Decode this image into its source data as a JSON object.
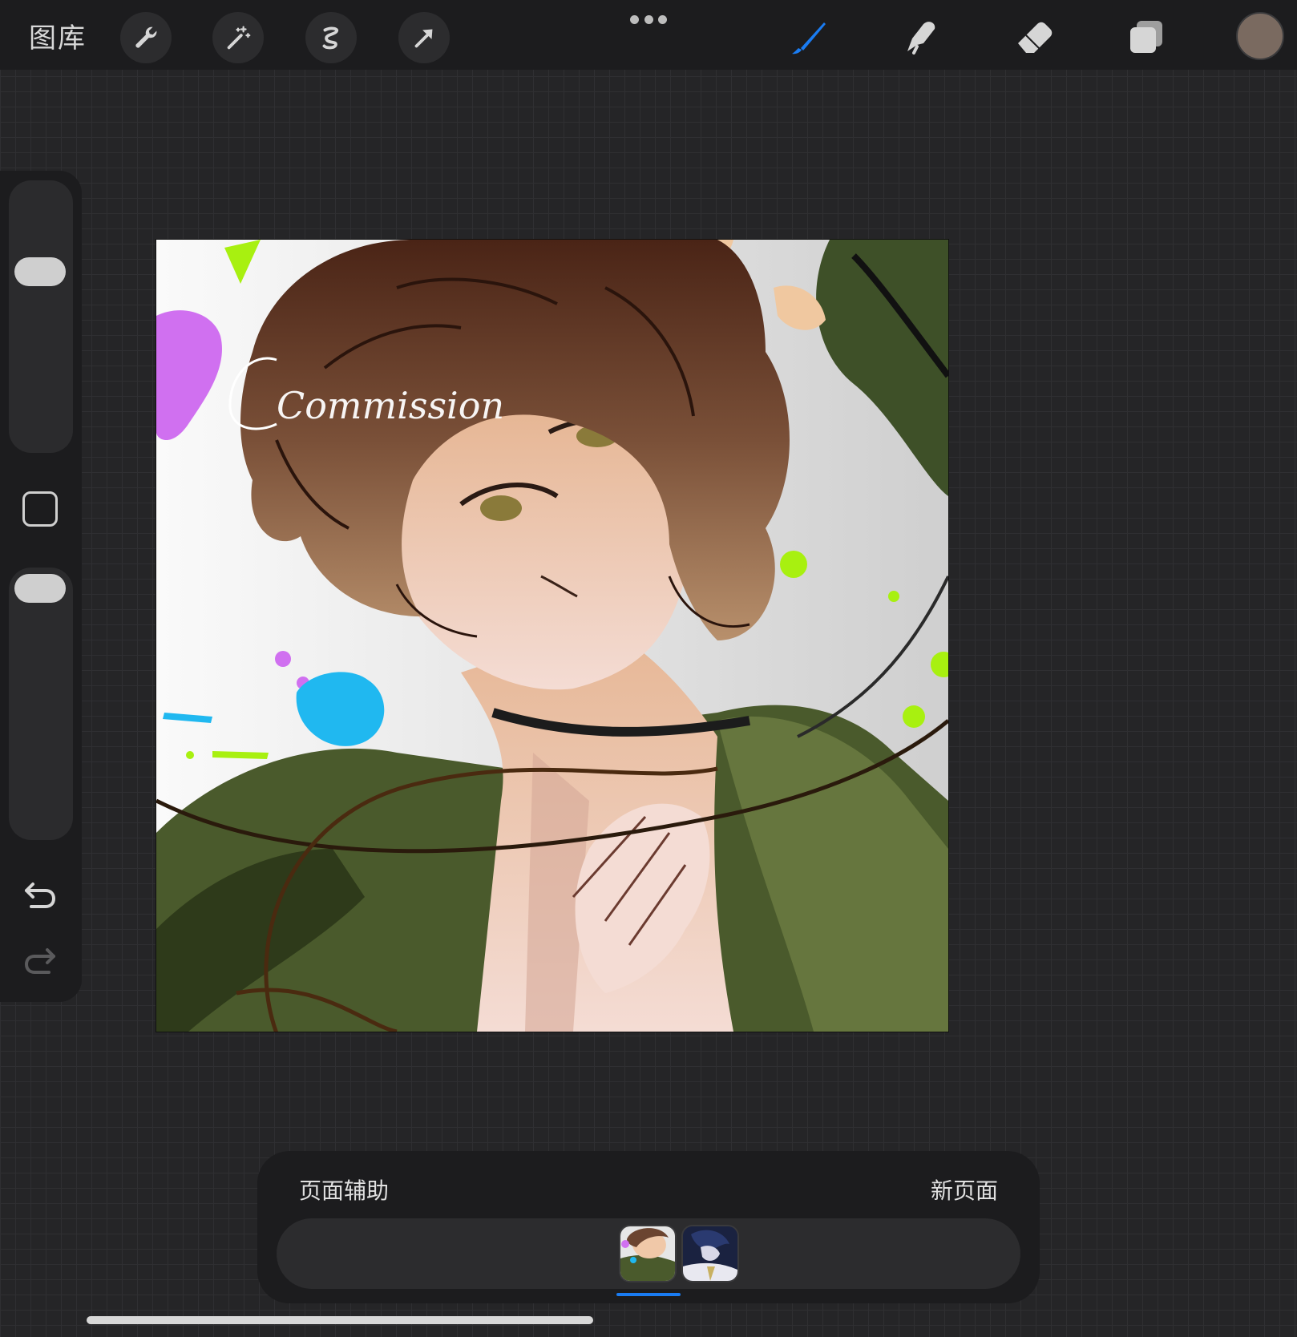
{
  "topbar": {
    "gallery_label": "图库",
    "left_tools": [
      "wrench-icon",
      "magic-wand-icon",
      "selection-icon",
      "transform-arrow-icon"
    ],
    "more_menu": "ellipsis-icon",
    "right_tools": [
      "brush-icon",
      "smudge-icon",
      "eraser-icon",
      "layers-icon"
    ],
    "active_tool": "brush",
    "accent_color": "#1a7cf2",
    "current_color": "#7a6a60"
  },
  "canvas": {
    "watermark": "Commission",
    "palette": {
      "hair": "#6b4430",
      "skin": "#f0c8a8",
      "coat": "#4a5a2c",
      "purple": "#d070f0",
      "cyan": "#20b8f0",
      "lime": "#a8f010"
    }
  },
  "page_assist": {
    "title": "页面辅助",
    "new_page": "新页面",
    "pages": [
      {
        "selected": true
      },
      {
        "selected": false
      }
    ]
  }
}
